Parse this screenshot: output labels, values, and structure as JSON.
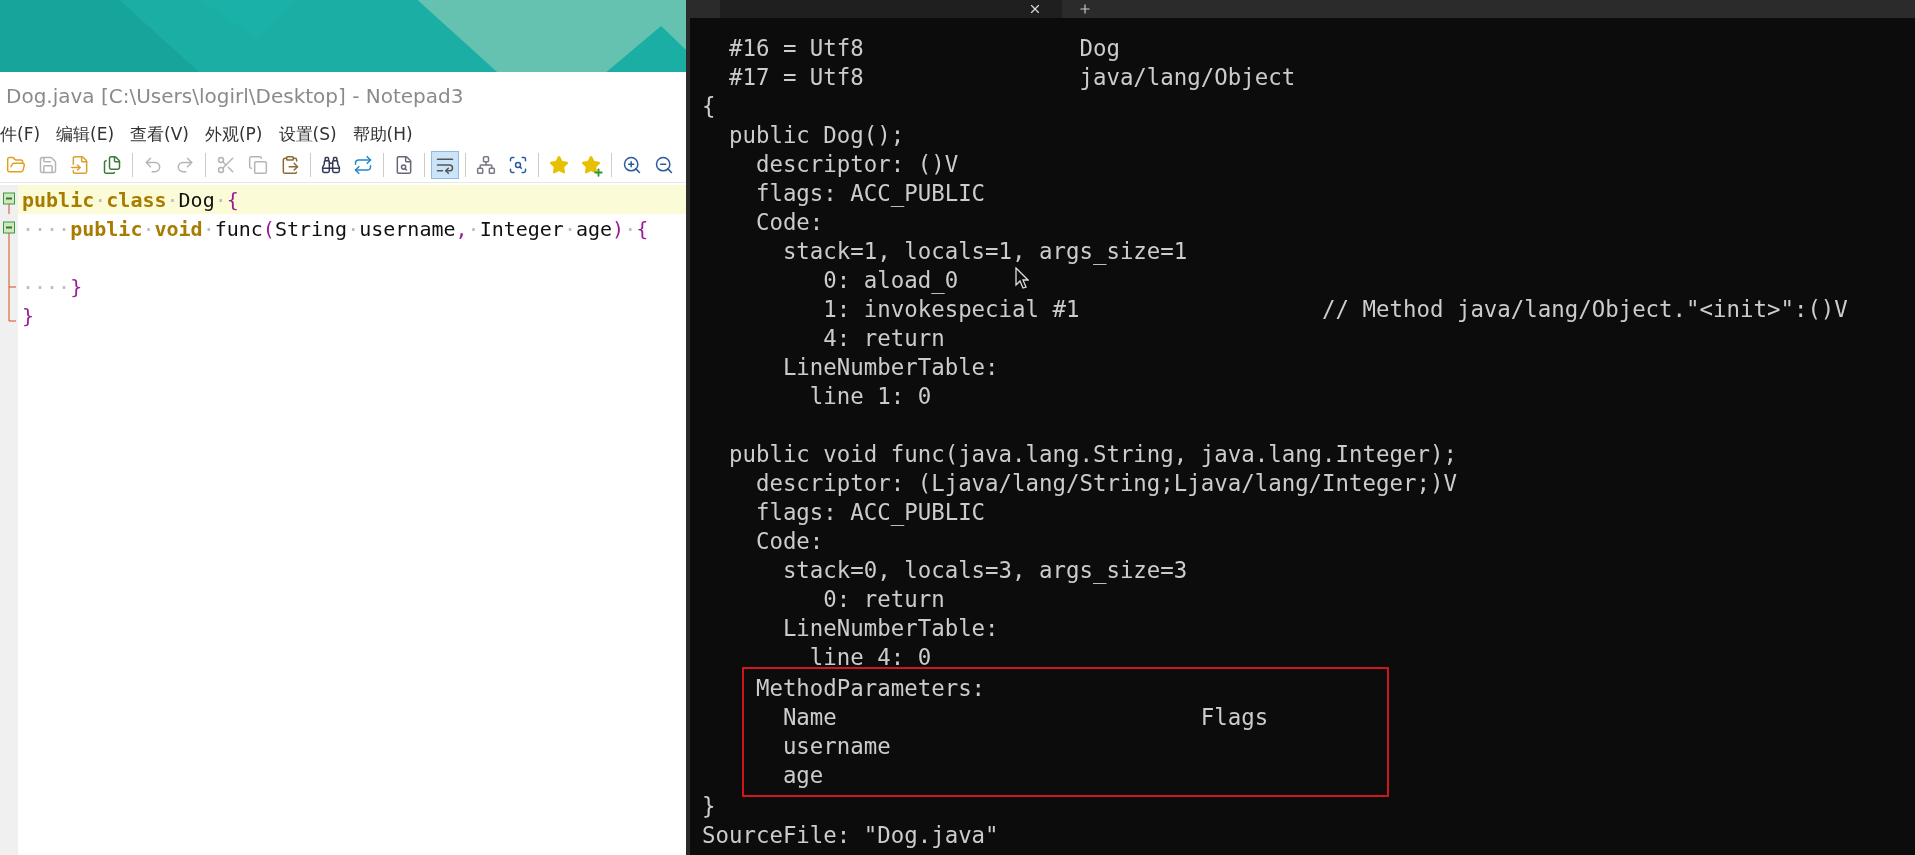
{
  "notepad": {
    "title": "Dog.java [C:\\Users\\logirl\\Desktop] - Notepad3",
    "menu": [
      "件(F)",
      "编辑(E)",
      "查看(V)",
      "外观(P)",
      "设置(S)",
      "帮助(H)"
    ],
    "toolbar": [
      {
        "kind": "open",
        "disabled": false,
        "selected": false
      },
      {
        "kind": "save",
        "disabled": true,
        "selected": false
      },
      {
        "kind": "import",
        "disabled": false,
        "selected": false
      },
      {
        "kind": "copy-file",
        "disabled": false,
        "selected": false
      },
      {
        "kind": "undo",
        "disabled": true,
        "selected": false
      },
      {
        "kind": "redo",
        "disabled": true,
        "selected": false
      },
      {
        "kind": "cut",
        "disabled": true,
        "selected": false
      },
      {
        "kind": "copy",
        "disabled": true,
        "selected": false
      },
      {
        "kind": "paste",
        "disabled": false,
        "selected": false
      },
      {
        "kind": "find",
        "disabled": false,
        "selected": false
      },
      {
        "kind": "replace",
        "disabled": false,
        "selected": false
      },
      {
        "kind": "zoom-page",
        "disabled": false,
        "selected": false
      },
      {
        "kind": "wrap",
        "disabled": false,
        "selected": true
      },
      {
        "kind": "tree",
        "disabled": false,
        "selected": false
      },
      {
        "kind": "scan",
        "disabled": false,
        "selected": false
      },
      {
        "kind": "star",
        "disabled": false,
        "selected": false
      },
      {
        "kind": "star-add",
        "disabled": false,
        "selected": false
      },
      {
        "kind": "zoom-in",
        "disabled": false,
        "selected": false
      },
      {
        "kind": "zoom-out",
        "disabled": false,
        "selected": false
      }
    ],
    "code": [
      {
        "current": true,
        "kind": "fold-start",
        "tokens": [
          {
            "kind": "keyword",
            "text": "public"
          },
          {
            "kind": "space",
            "text": "·"
          },
          {
            "kind": "keyword",
            "text": "class"
          },
          {
            "kind": "space",
            "text": "·"
          },
          {
            "kind": "plain",
            "text": "Dog"
          },
          {
            "kind": "space",
            "text": "·"
          },
          {
            "kind": "brace",
            "text": "{"
          }
        ]
      },
      {
        "current": false,
        "kind": "fold-start",
        "tokens": [
          {
            "kind": "space",
            "text": "····"
          },
          {
            "kind": "keyword",
            "text": "public"
          },
          {
            "kind": "space",
            "text": "·"
          },
          {
            "kind": "keyword",
            "text": "void"
          },
          {
            "kind": "space",
            "text": "·"
          },
          {
            "kind": "plain",
            "text": "func"
          },
          {
            "kind": "brace",
            "text": "("
          },
          {
            "kind": "plain",
            "text": "String"
          },
          {
            "kind": "space",
            "text": "·"
          },
          {
            "kind": "plain",
            "text": "username"
          },
          {
            "kind": "brace",
            "text": ","
          },
          {
            "kind": "space",
            "text": "·"
          },
          {
            "kind": "plain",
            "text": "Integer"
          },
          {
            "kind": "space",
            "text": "·"
          },
          {
            "kind": "plain",
            "text": "age"
          },
          {
            "kind": "brace",
            "text": ")"
          },
          {
            "kind": "space",
            "text": "·"
          },
          {
            "kind": "brace",
            "text": "{"
          }
        ]
      },
      {
        "current": false,
        "kind": "fold-body"
      },
      {
        "current": false,
        "kind": "fold-end",
        "tokens": [
          {
            "kind": "space",
            "text": "····"
          },
          {
            "kind": "brace",
            "text": "}"
          }
        ]
      },
      {
        "current": false,
        "kind": "fold-last",
        "tokens": [
          {
            "kind": "brace",
            "text": "}"
          }
        ]
      }
    ]
  },
  "terminal": {
    "header_lines": [
      "  #16 = Utf8                Dog",
      "  #17 = Utf8                java/lang/Object",
      "{",
      "  public Dog();",
      "    descriptor: ()V",
      "    flags: ACC_PUBLIC",
      "    Code:",
      "      stack=1, locals=1, args_size=1",
      "         0: aload_0",
      "         1: invokespecial #1                  // Method java/lang/Object.\"<init>\":()V",
      "         4: return",
      "      LineNumberTable:",
      "        line 1: 0"
    ],
    "method_lines": [
      "  public void func(java.lang.String, java.lang.Integer);",
      "    descriptor: (Ljava/lang/String;Ljava/lang/Integer;)V",
      "    flags: ACC_PUBLIC",
      "    Code:",
      "      stack=0, locals=3, args_size=3",
      "         0: return",
      "      LineNumberTable:",
      "        line 4: 0"
    ],
    "boxed_lines": [
      "    MethodParameters:",
      "      Name                           Flags",
      "      username",
      "      age"
    ],
    "lines_after": [
      "}",
      "SourceFile: \"Dog.java\""
    ]
  }
}
